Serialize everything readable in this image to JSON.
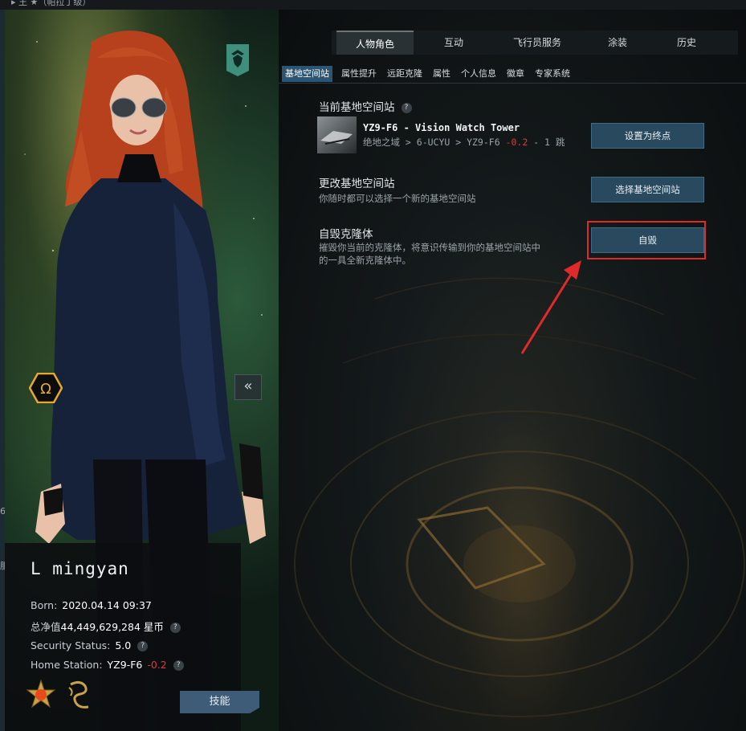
{
  "top_strip": {
    "text": "▸ 王 ★（帕拉丁级）"
  },
  "left_edge": {
    "mark1": "6",
    "mark2": "服"
  },
  "character": {
    "name": "L mingyan",
    "born_label": "Born:",
    "born_value": "2020.04.14 09:37",
    "networth_label": "总净值",
    "networth_value": "44,449,629,284 星币",
    "security_label": "Security Status:",
    "security_value": "5.0",
    "home_label": "Home Station:",
    "home_station": "YZ9-F6",
    "home_sec": "-0.2",
    "skills_button": "技能",
    "collapse_glyph": "«",
    "omega_glyph": "Ω",
    "help_glyph": "?"
  },
  "tabs": {
    "top": [
      "人物角色",
      "互动",
      "飞行员服务",
      "涂装",
      "历史"
    ],
    "top_active": "人物角色",
    "sub": [
      "基地空间站",
      "属性提升",
      "远距克隆",
      "属性",
      "个人信息",
      "徽章",
      "专家系统"
    ],
    "sub_active": "基地空间站"
  },
  "content": {
    "current_station_title": "当前基地空间站",
    "station_name": "YZ9-F6 - Vision Watch Tower",
    "station_route_prefix": "绝地之域 > 6-UCYU > YZ9-F6 ",
    "station_route_sec": "-0.2",
    "station_route_suffix": " - 1 跳",
    "set_destination_button": "设置为终点",
    "change_station_title": "更改基地空间站",
    "change_station_desc": "你随时都可以选择一个新的基地空间站",
    "select_station_button": "选择基地空间站",
    "self_destruct_title": "自毁克隆体",
    "self_destruct_desc_line1": "摧毁你当前的克隆体，将意识传输到你的基地空间站中",
    "self_destruct_desc_line2": "的一具全新克隆体中。",
    "self_destruct_button": "自毁",
    "help_glyph": "?"
  },
  "colors": {
    "accent_button": "#294a5e",
    "active_subtab": "#2b5572",
    "negative_security": "#e63535",
    "annotation_red": "#e02a2a",
    "omega_gold": "#e8a92a"
  },
  "icons": [
    "corp-emblem-icon",
    "omega-icon",
    "help-icon",
    "collapse-left-icon",
    "medal-icon",
    "dragon-emblem-icon",
    "station-thumbnail-icon",
    "annotation-arrow-icon"
  ]
}
